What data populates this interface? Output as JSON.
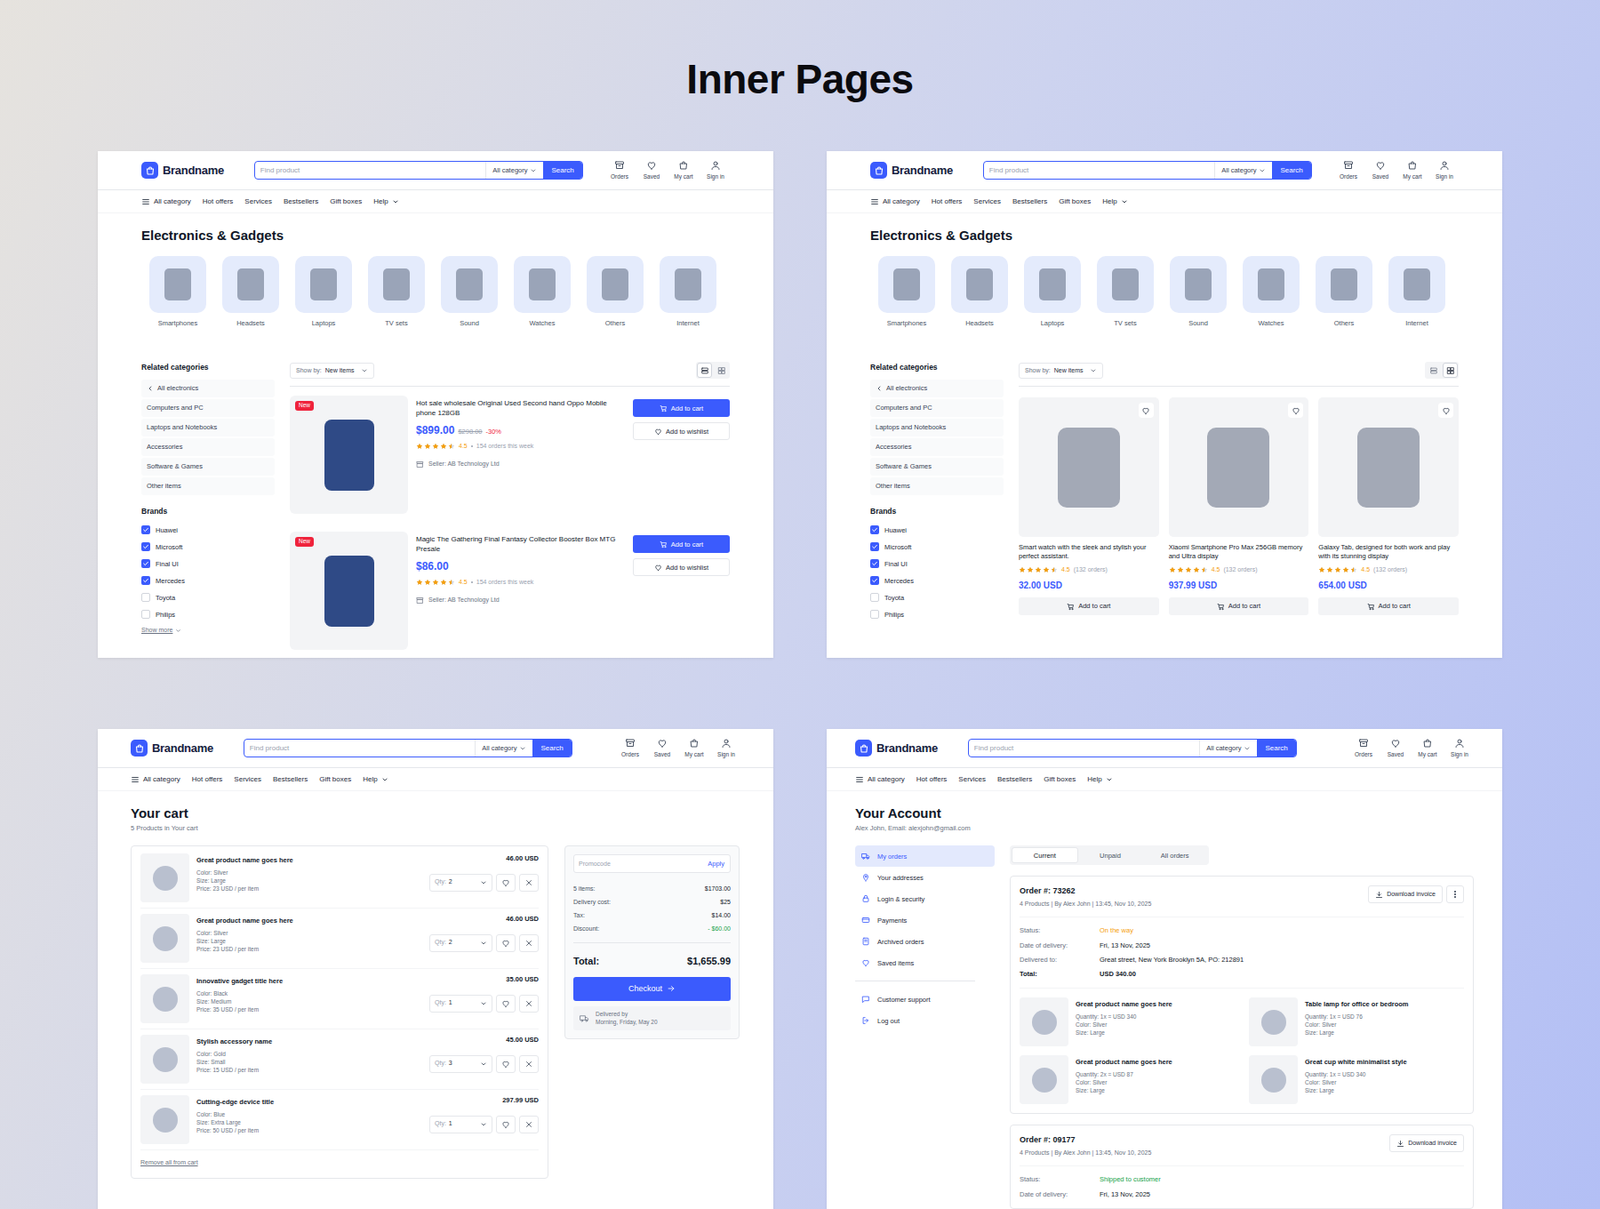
{
  "title": "Inner Pages",
  "pages": [
    {
      "kind": "catalog-list",
      "header": {
        "brand": "Brandname",
        "search": {
          "placeholder": "Find product",
          "category": "All category",
          "button": "Search"
        },
        "actions": [
          "Orders",
          "Saved",
          "My cart",
          "Sign in"
        ],
        "nav": [
          "All category",
          "Hot offers",
          "Services",
          "Bestsellers",
          "Gift boxes",
          "Help"
        ]
      },
      "heading": "Electronics & Gadgets",
      "categories": [
        "Smartphones",
        "Headsets",
        "Laptops",
        "TV sets",
        "Sound",
        "Watches",
        "Others",
        "Internet"
      ],
      "related": {
        "title": "Related categories",
        "items": [
          "All electronics",
          "Computers and PC",
          "Laptops and Notebooks",
          "Accessories",
          "Software & Games",
          "Other items"
        ]
      },
      "brands": {
        "title": "Brands",
        "items": [
          {
            "label": "Huawei",
            "checked": true
          },
          {
            "label": "Microsoft",
            "checked": true
          },
          {
            "label": "Final UI",
            "checked": true
          },
          {
            "label": "Mercedes",
            "checked": true
          },
          {
            "label": "Toyota",
            "checked": false
          },
          {
            "label": "Philips",
            "checked": false
          }
        ],
        "more": "Show more"
      },
      "toolbar": {
        "label": "Show by:",
        "value": "New items",
        "views": [
          {
            "kind": "list",
            "selected": true
          },
          {
            "kind": "grid",
            "selected": false
          }
        ]
      },
      "products": [
        {
          "badge": "New",
          "title": "Hot sale wholesale Original Used Second hand Oppo Mobile phone 128GB",
          "price": "$899.00",
          "old_price": "$298.00",
          "discount": "-30%",
          "stars": 4.5,
          "rating": "4.5",
          "orders": "154 orders this week",
          "seller": "Seller: AB Technology Ltd",
          "cart": "Add to cart",
          "wishlist": "Add to wishlist"
        },
        {
          "badge": "New",
          "title": "Magic The Gathering Final Fantasy Collector Booster Box MTG Presale",
          "price": "$86.00",
          "stars": 4.5,
          "rating": "4.5",
          "orders": "154 orders this week",
          "seller": "Seller: AB Technology Ltd",
          "cart": "Add to cart",
          "wishlist": "Add to wishlist"
        }
      ]
    },
    {
      "kind": "catalog-grid",
      "header": {
        "brand": "Brandname",
        "search": {
          "placeholder": "Find product",
          "category": "All category",
          "button": "Search"
        },
        "actions": [
          "Orders",
          "Saved",
          "My cart",
          "Sign in"
        ],
        "nav": [
          "All category",
          "Hot offers",
          "Services",
          "Bestsellers",
          "Gift boxes",
          "Help"
        ]
      },
      "heading": "Electronics & Gadgets",
      "categories": [
        "Smartphones",
        "Headsets",
        "Laptops",
        "TV sets",
        "Sound",
        "Watches",
        "Others",
        "Internet"
      ],
      "related": {
        "title": "Related categories",
        "items": [
          "All electronics",
          "Computers and PC",
          "Laptops and Notebooks",
          "Accessories",
          "Software & Games",
          "Other items"
        ]
      },
      "brands": {
        "title": "Brands",
        "items": [
          {
            "label": "Huawei",
            "checked": true
          },
          {
            "label": "Microsoft",
            "checked": true
          },
          {
            "label": "Final UI",
            "checked": true
          },
          {
            "label": "Mercedes",
            "checked": true
          },
          {
            "label": "Toyota",
            "checked": false
          },
          {
            "label": "Philips",
            "checked": false
          }
        ]
      },
      "toolbar": {
        "label": "Show by:",
        "value": "New items",
        "views": [
          {
            "kind": "list",
            "selected": false
          },
          {
            "kind": "grid",
            "selected": true
          }
        ]
      },
      "products": [
        {
          "title": "Smart watch with the sleek and stylish your perfect assistant.",
          "stars": 4.5,
          "rating": "4.5",
          "orders": "(132 orders)",
          "price": "32.00 USD",
          "cart": "Add to cart"
        },
        {
          "title": "Xiaomi Smartphone Pro Max 256GB memory and Ultra display",
          "stars": 4.5,
          "rating": "4.5",
          "orders": "(132 orders)",
          "price": "937.99 USD",
          "cart": "Add to cart"
        },
        {
          "title": "Galaxy Tab, designed for both work and play with its stunning display",
          "stars": 4.5,
          "rating": "4.5",
          "orders": "(132 orders)",
          "price": "654.00 USD",
          "cart": "Add to cart"
        }
      ]
    },
    {
      "kind": "cart",
      "header": {
        "brand": "Brandname",
        "search": {
          "placeholder": "Find product",
          "category": "All category",
          "button": "Search"
        },
        "actions": [
          "Orders",
          "Saved",
          "My cart",
          "Sign in"
        ],
        "nav": [
          "All category",
          "Hot offers",
          "Services",
          "Bestsellers",
          "Gift boxes",
          "Help"
        ]
      },
      "heading": "Your cart",
      "subtitle": "5 Products in Your cart",
      "items": [
        {
          "name": "Great product name goes here",
          "details": [
            "Color: Silver",
            "Size: Large",
            "Price: 23 USD / per item"
          ],
          "qty_label": "Qty:",
          "qty": "2",
          "total": "46.00 USD"
        },
        {
          "name": "Great product name goes here",
          "details": [
            "Color: Silver",
            "Size: Large",
            "Price: 23 USD / per item"
          ],
          "qty_label": "Qty:",
          "qty": "2",
          "total": "46.00 USD"
        },
        {
          "name": "Innovative gadget title here",
          "details": [
            "Color: Black",
            "Size: Medium",
            "Price: 35 USD / per item"
          ],
          "qty_label": "Qty:",
          "qty": "1",
          "total": "35.00 USD"
        },
        {
          "name": "Stylish accessory name",
          "details": [
            "Color: Gold",
            "Size: Small",
            "Price: 15 USD / per item"
          ],
          "qty_label": "Qty:",
          "qty": "3",
          "total": "45.00 USD"
        },
        {
          "name": "Cutting-edge device title",
          "details": [
            "Color: Blue",
            "Size: Extra Large",
            "Price: 50 USD / per item"
          ],
          "qty_label": "Qty:",
          "qty": "1",
          "total": "297.99 USD"
        }
      ],
      "remove_all": "Remove all from cart",
      "summary": {
        "promo_placeholder": "Promocode",
        "apply": "Apply",
        "lines": [
          {
            "label": "5 items:",
            "value": "$1703.00",
            "color": "#111827"
          },
          {
            "label": "Delivery cost:",
            "value": "$25",
            "color": "#111827"
          },
          {
            "label": "Tax:",
            "value": "$14.00",
            "color": "#111827"
          },
          {
            "label": "Discount:",
            "value": "- $60.00",
            "color": "#16a34a"
          }
        ],
        "total_label": "Total:",
        "total": "$1,655.99",
        "checkout": "Checkout",
        "delivery_label": "Delivered by",
        "delivery": "Morning, Friday, May 20"
      }
    },
    {
      "kind": "account",
      "header": {
        "brand": "Brandname",
        "search": {
          "placeholder": "Find product",
          "category": "All category",
          "button": "Search"
        },
        "actions": [
          "Orders",
          "Saved",
          "My cart",
          "Sign in"
        ],
        "nav": [
          "All category",
          "Hot offers",
          "Services",
          "Bestsellers",
          "Gift boxes",
          "Help"
        ]
      },
      "heading": "Your Account",
      "subtitle": "Alex John, Email: alexjohn@gmail.com",
      "menu": [
        [
          {
            "label": "My orders",
            "selected": true
          },
          {
            "label": "Your addresses",
            "selected": false
          },
          {
            "label": "Login & security",
            "selected": false
          },
          {
            "label": "Payments",
            "selected": false
          },
          {
            "label": "Archived orders",
            "selected": false
          },
          {
            "label": "Saved items",
            "selected": false
          }
        ],
        [
          {
            "label": "Customer support",
            "selected": false
          },
          {
            "label": "Log out",
            "selected": false
          }
        ]
      ],
      "tabs": [
        {
          "label": "Current",
          "selected": true
        },
        {
          "label": "Unpaid",
          "selected": false
        },
        {
          "label": "All orders",
          "selected": false
        }
      ],
      "orders": [
        {
          "number": "Order #: 73262",
          "meta": "4 Products | By Alex John | 13:45, Nov 10, 2025",
          "invoice": "Download invoice",
          "more_menu": true,
          "fields": [
            {
              "label": "Status:",
              "value": "On the way",
              "kind": "status",
              "color": "#f59e0b"
            },
            {
              "label": "Date of delivery:",
              "value": "Fri, 13 Nov, 2025",
              "kind": "plain",
              "color": "#111827"
            },
            {
              "label": "Delivered to:",
              "value": "Great street, New York Brooklyn 5A, PO: 212891",
              "kind": "plain",
              "color": "#111827"
            },
            {
              "label": "Total:",
              "value": "USD 340.00",
              "kind": "total",
              "color": "#111827"
            }
          ],
          "items": [
            {
              "name": "Great product name goes here",
              "details": [
                "Quantity: 1x = USD 340",
                "Color: Silver",
                "Size: Large"
              ]
            },
            {
              "name": "Table lamp for office or bedroom",
              "details": [
                "Quantity: 1x = USD 76",
                "Color: Silver",
                "Size: Large"
              ]
            },
            {
              "name": "Great product name goes here",
              "details": [
                "Quantity: 2x = USD 87",
                "Color: Silver",
                "Size: Large"
              ]
            },
            {
              "name": "Great cup white minimalist style",
              "details": [
                "Quantity: 1x = USD 340",
                "Color: Silver",
                "Size: Large"
              ]
            }
          ]
        },
        {
          "number": "Order #: 09177",
          "meta": "4 Products | By Alex John | 13:45, Nov 10, 2025",
          "invoice": "Download invoice",
          "more_menu": false,
          "fields": [
            {
              "label": "Status:",
              "value": "Shipped to customer",
              "kind": "status",
              "color": "#16a34a"
            },
            {
              "label": "Date of delivery:",
              "value": "Fri, 13 Nov, 2025",
              "kind": "plain",
              "color": "#111827"
            }
          ]
        }
      ]
    }
  ]
}
